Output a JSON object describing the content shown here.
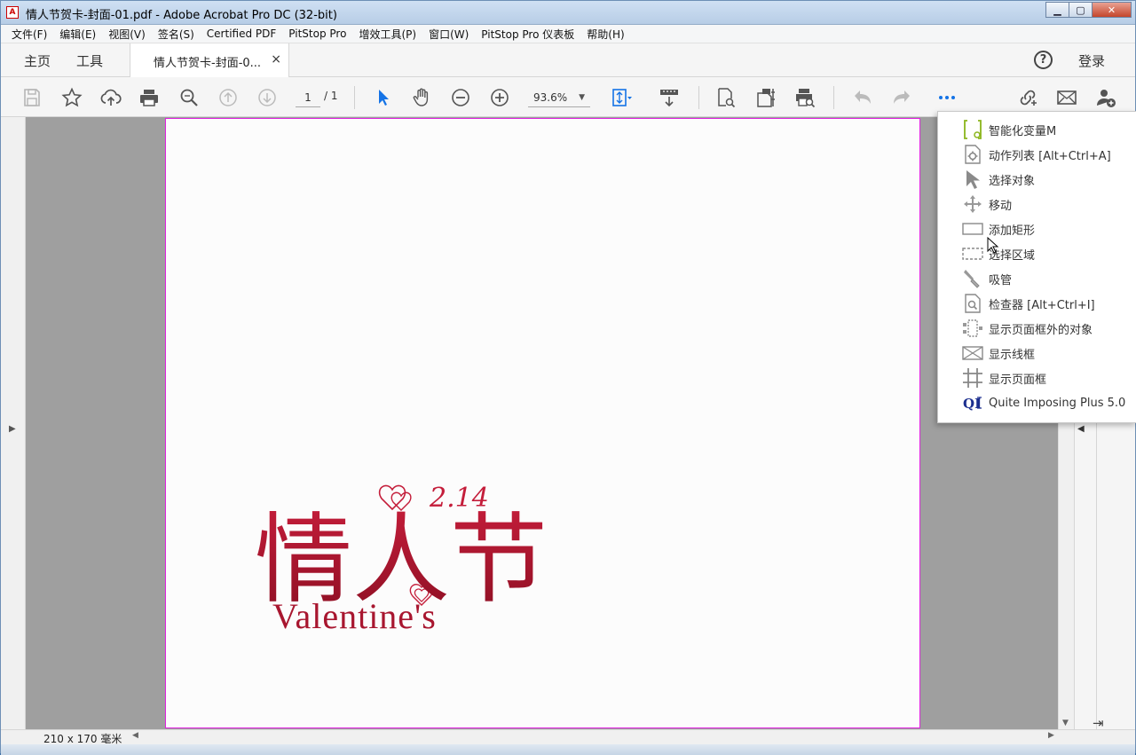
{
  "window": {
    "title": "情人节贺卡-封面-01.pdf - Adobe Acrobat Pro DC (32-bit)",
    "minimize": "▁",
    "maximize": "▢",
    "close": "✕"
  },
  "menu": [
    "文件(F)",
    "编辑(E)",
    "视图(V)",
    "签名(S)",
    "Certified PDF",
    "PitStop Pro",
    "增效工具(P)",
    "窗口(W)",
    "PitStop Pro 仪表板",
    "帮助(H)"
  ],
  "tabs": {
    "home": "主页",
    "tools": "工具",
    "doc": "情人节贺卡-封面-0...",
    "doc_close": "×",
    "help": "?",
    "login": "登录"
  },
  "toolbar": {
    "page_current": "1",
    "page_total": "/ 1",
    "zoom": "93.6%"
  },
  "artwork": {
    "headline": "情人节",
    "date": "2.14",
    "subtitle": "Valentine's"
  },
  "status": {
    "page_size": "210 x 170 毫米"
  },
  "tools_menu": [
    {
      "label": "智能化变量M",
      "icon": "smart-variable-icon"
    },
    {
      "label": "动作列表 [Alt+Ctrl+A]",
      "icon": "action-list-icon"
    },
    {
      "label": "选择对象",
      "icon": "select-object-icon"
    },
    {
      "label": "移动",
      "icon": "move-icon"
    },
    {
      "label": "添加矩形",
      "icon": "add-rectangle-icon"
    },
    {
      "label": "选择区域",
      "icon": "select-area-icon"
    },
    {
      "label": "吸管",
      "icon": "eyedropper-icon"
    },
    {
      "label": "检查器 [Alt+Ctrl+I]",
      "icon": "inspector-icon"
    },
    {
      "label": "显示页面框外的对象",
      "icon": "show-offpage-objects-icon"
    },
    {
      "label": "显示线框",
      "icon": "wireframe-icon"
    },
    {
      "label": "显示页面框",
      "icon": "page-boxes-icon"
    },
    {
      "label": "Quite Imposing Plus 5.0",
      "icon": "quite-imposing-icon"
    }
  ],
  "colors": {
    "accent": "#1473e6",
    "artwork_red": "#b0172e",
    "page_border": "#e020e0"
  }
}
